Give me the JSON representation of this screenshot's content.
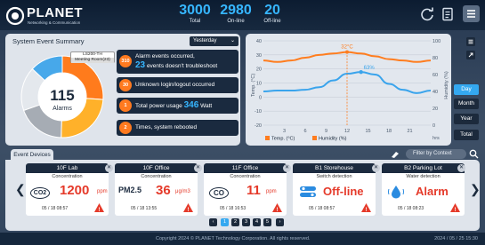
{
  "header": {
    "brand": "PLANET",
    "tagline": "Networking & Communication",
    "stats": [
      {
        "value": "3000",
        "label": "Total"
      },
      {
        "value": "2980",
        "label": "On-line"
      },
      {
        "value": "20",
        "label": "Off-line"
      }
    ]
  },
  "summary": {
    "title": "System Event Summary",
    "period": "Yesterday",
    "donut_total": "115",
    "donut_label": "Alarms",
    "tooltip": {
      "line1": "LS200-TH",
      "line2": "Meeting Room(23)"
    },
    "donut_slices": [
      {
        "value": 30,
        "color": "#ff7b1c"
      },
      {
        "value": 28,
        "color": "#ffb12a"
      },
      {
        "value": 22,
        "color": "#a6acb4"
      },
      {
        "value": 20,
        "color": "#e4e8ed"
      },
      {
        "value": 15,
        "color": "#47a8ea"
      }
    ],
    "alarms": [
      {
        "badge": "310",
        "line1": "Alarm events occurred,",
        "line2_num": "23",
        "line2": "events doesn't troubleshoot"
      },
      {
        "badge": "30",
        "line1": "Unknown login/logout occurred"
      },
      {
        "badge": "1",
        "line1_pre": "Total power usage",
        "line1_num": "346",
        "line1_post": "Watt"
      },
      {
        "badge": "2",
        "line1": "Times, system rebooted"
      }
    ]
  },
  "chart_data": {
    "type": "line",
    "x_ticks": [
      "3",
      "6",
      "9",
      "12",
      "15",
      "18",
      "21"
    ],
    "x_unit": "hrs",
    "ylabel_left": "Temp. (°C)",
    "ylabel_right": "Humidity (%)",
    "left_ticks": [
      "40",
      "30",
      "20",
      "10",
      "0",
      "-10",
      "-20"
    ],
    "right_ticks": [
      "100",
      "80",
      "60",
      "40",
      "20",
      "0"
    ],
    "ylim_left": [
      -20,
      40
    ],
    "ylim_right": [
      0,
      100
    ],
    "peak_label": "32°C",
    "hum_label": "63%",
    "legend": [
      "Temp. (°C)",
      "Humidity (%)"
    ],
    "series": [
      {
        "name": "Temp. (°C)",
        "color": "#ff7d1f",
        "x": [
          0,
          2,
          4,
          6,
          8,
          10,
          12,
          14,
          16,
          18,
          20,
          22,
          24
        ],
        "values": [
          26,
          25,
          26,
          28,
          30,
          31,
          32,
          31,
          29,
          27,
          26,
          25,
          26
        ]
      },
      {
        "name": "Humidity (%)",
        "color": "#3aa4ec",
        "x": [
          0,
          2,
          4,
          6,
          8,
          10,
          12,
          14,
          16,
          18,
          20,
          22,
          24
        ],
        "values": [
          40,
          41,
          41,
          42,
          45,
          53,
          61,
          63,
          60,
          49,
          42,
          38,
          41
        ]
      }
    ]
  },
  "range_buttons": [
    "Day",
    "Month",
    "Year",
    "Total"
  ],
  "events": {
    "tab": "Event Devices",
    "filter_placeholder": "Filter by Context",
    "cards": [
      {
        "title": "10F Lab",
        "type": "Concentration",
        "icon": "CO2",
        "value": "1200",
        "unit": "ppm",
        "date": "05 / 18 08:57"
      },
      {
        "title": "10F Office",
        "type": "Concentration",
        "icon": "PM2.5",
        "value": "36",
        "unit": "μg/m3",
        "date": "05 / 18 13:55"
      },
      {
        "title": "11F Office",
        "type": "Concentration",
        "icon": "CO",
        "value": "11",
        "unit": "ppm",
        "date": "05 / 18 16:53"
      },
      {
        "title": "B1 Storehouse",
        "type": "Switch detection",
        "icon": "switch",
        "value": "Off-line",
        "unit": "",
        "date": "05 / 18 08:57"
      },
      {
        "title": "B2 Parking Lot",
        "type": "Water detection",
        "icon": "water",
        "value": "Alarm",
        "unit": "",
        "date": "05 / 18 08:23"
      }
    ],
    "pages": [
      "1",
      "2",
      "3",
      "4",
      "5"
    ]
  },
  "footer": {
    "copyright": "Copyright 2024 © PLANET Technology Corporation. All rights reserved.",
    "datetime": "2024 / 05 / 25 15:30"
  }
}
